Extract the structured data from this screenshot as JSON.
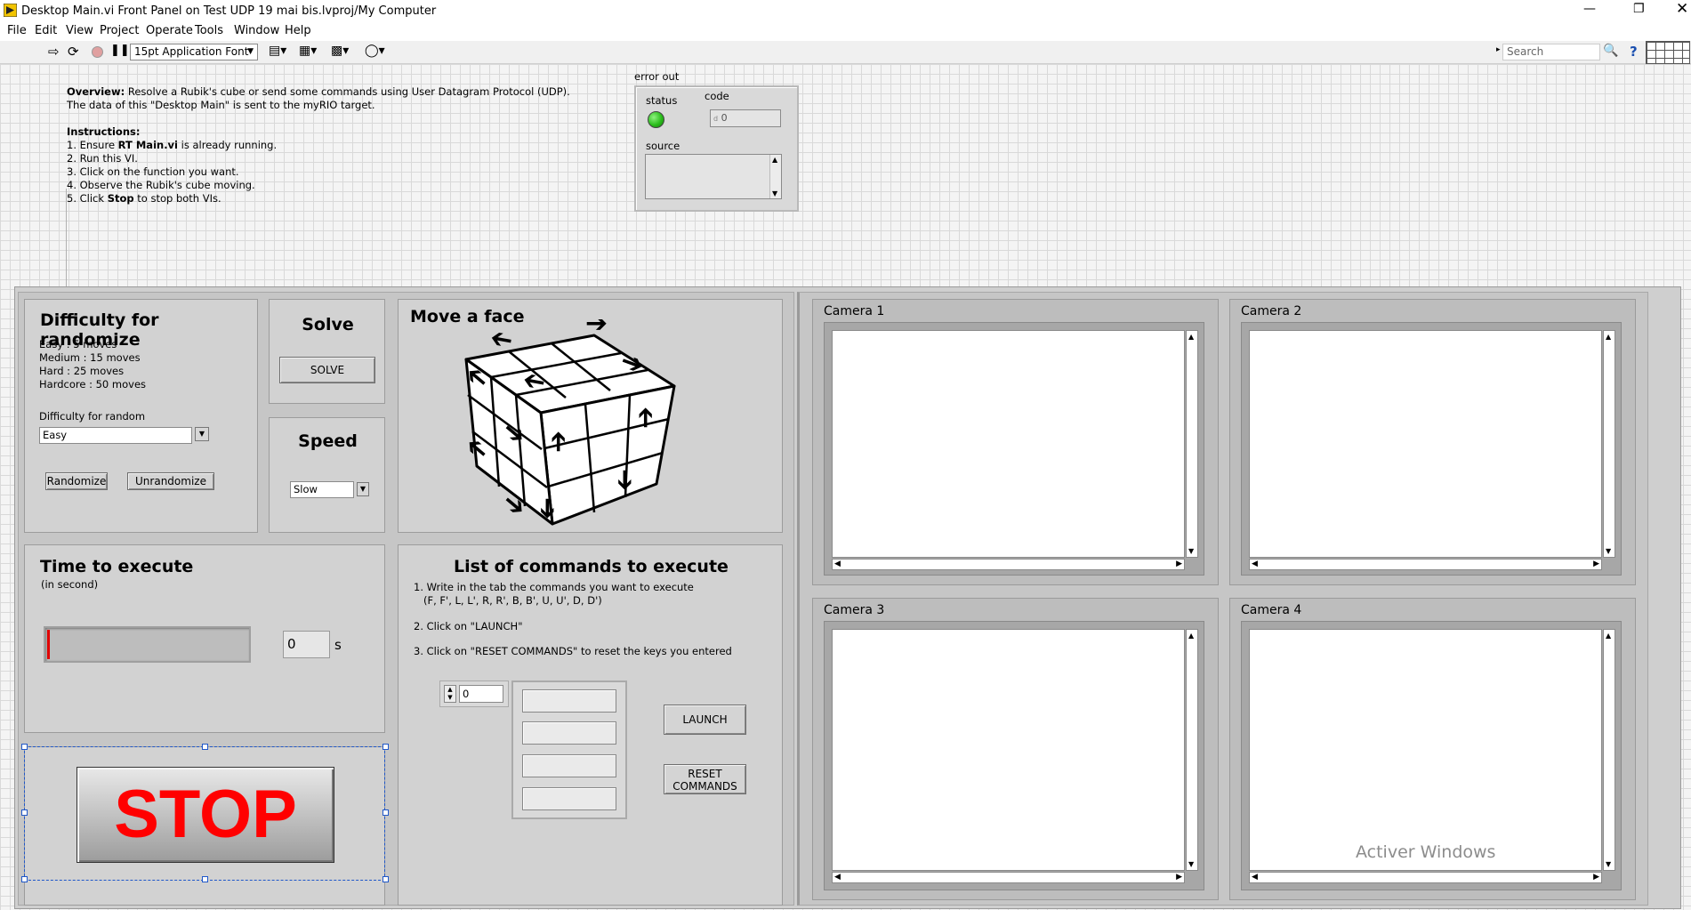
{
  "window": {
    "title": "Desktop Main.vi Front Panel on Test UDP 19 mai bis.lvproj/My Computer"
  },
  "menu": [
    "File",
    "Edit",
    "View",
    "Project",
    "Operate",
    "Tools",
    "Window",
    "Help"
  ],
  "toolbar": {
    "font": "15pt Application Font",
    "search_placeholder": "Search"
  },
  "overview": {
    "overview_label": "Overview:",
    "overview_text": " Resolve a Rubik's cube or send some commands using User Datagram Protocol (UDP).",
    "overview_line2": "The data of this \"Desktop Main\" is sent to the myRIO target.",
    "instructions_label": "Instructions:",
    "step1_pre": "1. Ensure ",
    "step1_bold": "RT Main.vi",
    "step1_post": " is already running.",
    "step2": "2. Run this VI.",
    "step3": "3. Click on the function you want.",
    "step4": "4. Observe the Rubik's cube moving.",
    "step5_pre": "5. Click ",
    "step5_bold": "Stop",
    "step5_post": " to stop both VIs."
  },
  "error_out": {
    "label": "error out",
    "status_label": "status",
    "code_label": "code",
    "code_value": "0",
    "code_prefix": "d",
    "source_label": "source",
    "status_color": "#2bbd1c"
  },
  "difficulty": {
    "title": "Difficulty for randomize",
    "lines": [
      "Easy : 5 moves",
      "Medium : 15 moves",
      "Hard : 25 moves",
      "Hardcore : 50 moves"
    ],
    "select_label": "Difficulty for random",
    "select_value": "Easy",
    "randomize": "Randomize",
    "unrandomize": "Unrandomize"
  },
  "solve": {
    "title": "Solve",
    "button": "SOLVE"
  },
  "speed": {
    "title": "Speed",
    "value": "Slow"
  },
  "time": {
    "title": "Time to execute",
    "subtitle": "(in second)",
    "value": "0",
    "unit": "s"
  },
  "stop": {
    "label": "STOP",
    "color": "#ff0000"
  },
  "move": {
    "title": "Move a face"
  },
  "commands": {
    "title": "List of commands to execute",
    "step1": "1. Write in the tab the commands you want to execute",
    "step1b": "(F, F', L, L', R, R', B, B', U, U', D, D')",
    "step2": "2. Click on \"LAUNCH\"",
    "step3": "3. Click on \"RESET COMMANDS\" to reset the keys you entered",
    "index": "0",
    "launch": "LAUNCH",
    "reset_line1": "RESET",
    "reset_line2": "COMMANDS"
  },
  "cameras": [
    "Camera 1",
    "Camera 2",
    "Camera 3",
    "Camera 4"
  ],
  "watermark": "Activer Windows"
}
